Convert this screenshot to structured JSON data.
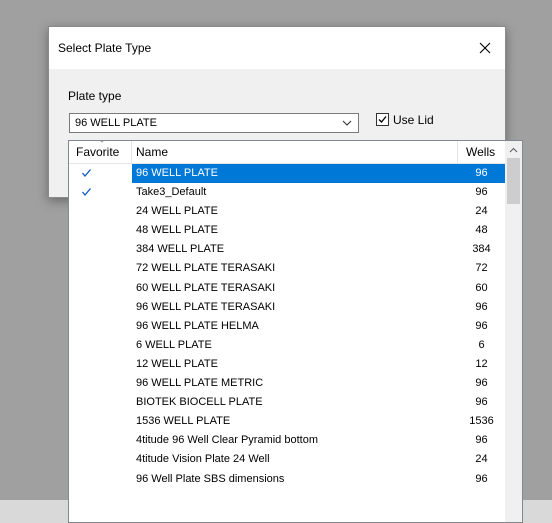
{
  "dialog": {
    "title": "Select Plate Type",
    "plate_type_label": "Plate type",
    "selected_plate": "96 WELL PLATE",
    "use_lid_label": "Use Lid",
    "use_lid_checked": true
  },
  "list": {
    "columns": {
      "favorite": "Favorite",
      "name": "Name",
      "wells": "Wells"
    },
    "rows": [
      {
        "favorite": true,
        "name": "96 WELL PLATE",
        "wells": "96",
        "selected": true
      },
      {
        "favorite": true,
        "name": "Take3_Default",
        "wells": "96"
      },
      {
        "favorite": false,
        "name": "24 WELL PLATE",
        "wells": "24"
      },
      {
        "favorite": false,
        "name": "48 WELL PLATE",
        "wells": "48"
      },
      {
        "favorite": false,
        "name": "384 WELL PLATE",
        "wells": "384"
      },
      {
        "favorite": false,
        "name": "72 WELL PLATE TERASAKI",
        "wells": "72"
      },
      {
        "favorite": false,
        "name": "60 WELL PLATE TERASAKI",
        "wells": "60"
      },
      {
        "favorite": false,
        "name": "96 WELL PLATE TERASAKI",
        "wells": "96"
      },
      {
        "favorite": false,
        "name": "96 WELL PLATE HELMA",
        "wells": "96"
      },
      {
        "favorite": false,
        "name": "6 WELL PLATE",
        "wells": "6"
      },
      {
        "favorite": false,
        "name": "12 WELL PLATE",
        "wells": "12"
      },
      {
        "favorite": false,
        "name": "96 WELL PLATE METRIC",
        "wells": "96"
      },
      {
        "favorite": false,
        "name": "BIOTEK BIOCELL PLATE",
        "wells": "96"
      },
      {
        "favorite": false,
        "name": "1536 WELL PLATE",
        "wells": "1536"
      },
      {
        "favorite": false,
        "name": "4titude 96 Well Clear Pyramid bottom",
        "wells": "96"
      },
      {
        "favorite": false,
        "name": "4titude Vision Plate 24 Well",
        "wells": "24"
      },
      {
        "favorite": false,
        "name": "96 Well Plate SBS dimensions",
        "wells": "96"
      }
    ]
  },
  "colors": {
    "selection": "#0078d7",
    "check": "#0a5bc4",
    "backdrop": "#a0a0a0"
  },
  "icons": {
    "close": "close-icon",
    "dropdown": "chevron-down-icon",
    "check": "check-icon",
    "scroll_up": "chevron-up-icon"
  }
}
